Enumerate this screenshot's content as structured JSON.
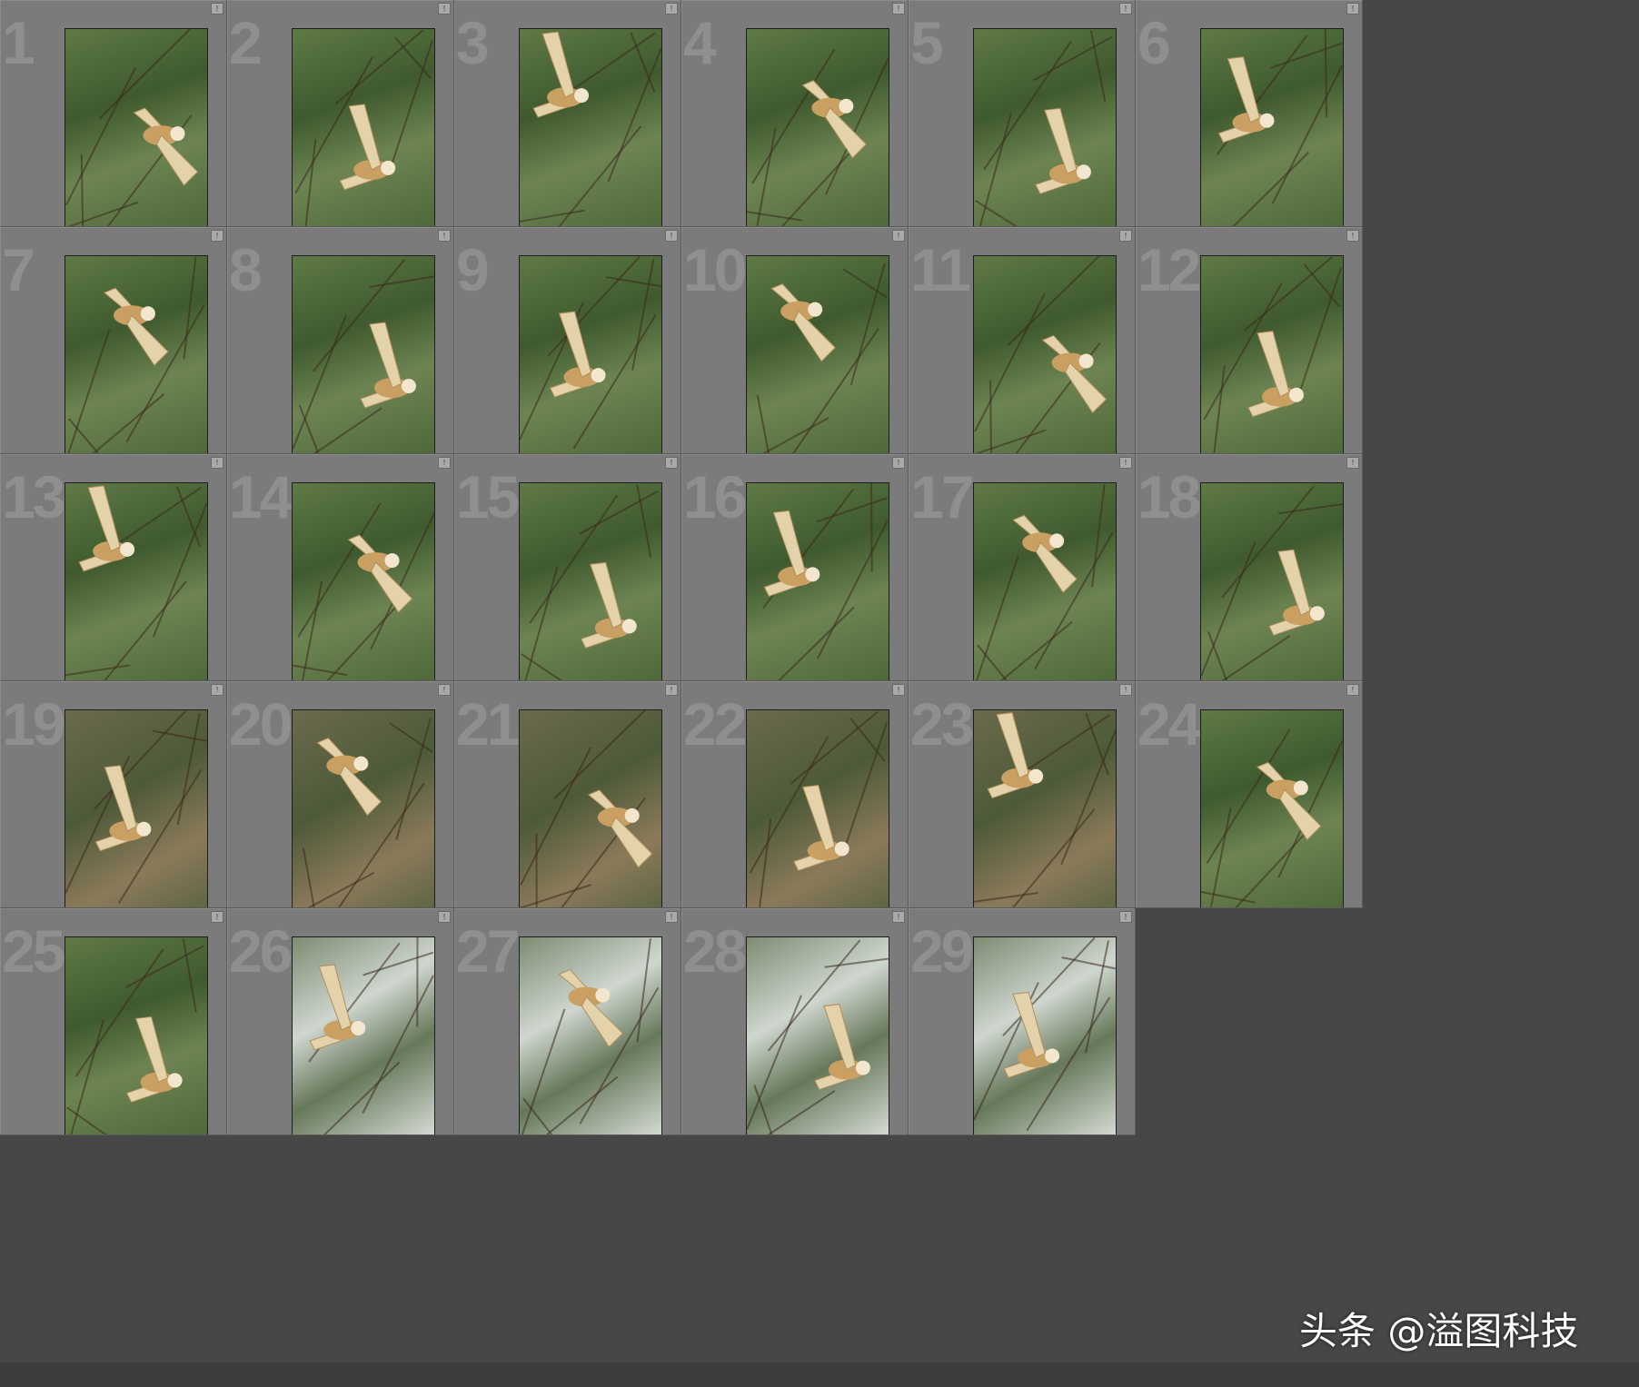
{
  "cells": [
    {
      "index": "1",
      "bg": "green"
    },
    {
      "index": "2",
      "bg": "green"
    },
    {
      "index": "3",
      "bg": "green"
    },
    {
      "index": "4",
      "bg": "green"
    },
    {
      "index": "5",
      "bg": "green"
    },
    {
      "index": "6",
      "bg": "green"
    },
    {
      "index": "7",
      "bg": "green"
    },
    {
      "index": "8",
      "bg": "green"
    },
    {
      "index": "9",
      "bg": "green"
    },
    {
      "index": "10",
      "bg": "green"
    },
    {
      "index": "11",
      "bg": "green"
    },
    {
      "index": "12",
      "bg": "green"
    },
    {
      "index": "13",
      "bg": "green"
    },
    {
      "index": "14",
      "bg": "green"
    },
    {
      "index": "15",
      "bg": "green"
    },
    {
      "index": "16",
      "bg": "green"
    },
    {
      "index": "17",
      "bg": "green"
    },
    {
      "index": "18",
      "bg": "green"
    },
    {
      "index": "19",
      "bg": "warm"
    },
    {
      "index": "20",
      "bg": "warm"
    },
    {
      "index": "21",
      "bg": "warm"
    },
    {
      "index": "22",
      "bg": "warm"
    },
    {
      "index": "23",
      "bg": "warm"
    },
    {
      "index": "24",
      "bg": "green"
    },
    {
      "index": "25",
      "bg": "green"
    },
    {
      "index": "26",
      "bg": "pale"
    },
    {
      "index": "27",
      "bg": "pale"
    },
    {
      "index": "28",
      "bg": "pale"
    },
    {
      "index": "29",
      "bg": "pale"
    }
  ],
  "badge_glyph": "!",
  "watermark": "头条 @溢图科技",
  "colors": {
    "cell_bg": "#7b7b7b",
    "app_bg": "#474747",
    "index_text": "#8f8f8f"
  }
}
